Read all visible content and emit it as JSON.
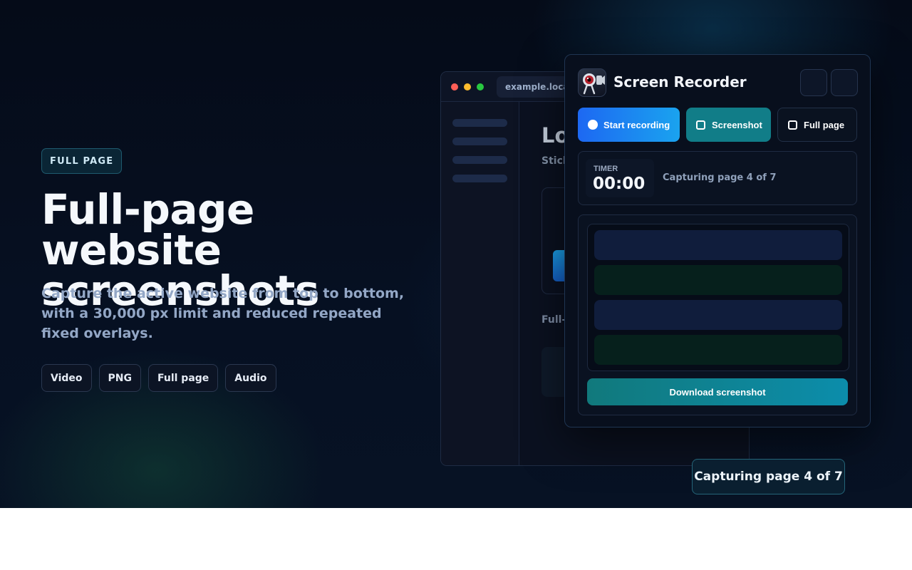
{
  "hero": {
    "badge": "FULL PAGE",
    "title": "Full-page website screenshots",
    "subtitle": "Capture the active website from top to bottom, with a 30,000 px limit and reduced repeated fixed overlays.",
    "chips": [
      "Video",
      "PNG",
      "Full page",
      "Audio"
    ]
  },
  "browser": {
    "url": "example.local",
    "page_title": "Lo",
    "page_subtitle": "Stick",
    "footer_text": "Full-",
    "traffic_lights": [
      "#ff5f57",
      "#febc2e",
      "#28c840"
    ]
  },
  "recorder": {
    "title": "Screen Recorder",
    "icon": "camera-lens-icon",
    "actions": {
      "start_recording": "Start recording",
      "screenshot": "Screenshot",
      "full_page": "Full page"
    },
    "timer": {
      "label": "TIMER",
      "value": "00:00",
      "status": "Capturing page 4 of 7"
    },
    "capture_progress": {
      "current_page": 4,
      "total_pages": 7
    },
    "download_label": "Download screenshot"
  },
  "toast": {
    "text": "Capturing page 4 of 7"
  },
  "colors": {
    "background": "#050b18",
    "accent_blue": "#1d68f2",
    "accent_teal": "#117d88",
    "text_primary": "#f5f8fc",
    "text_muted": "#93a7c6"
  }
}
